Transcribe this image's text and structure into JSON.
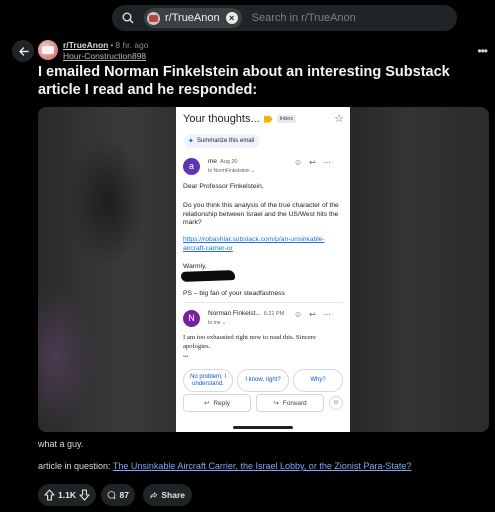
{
  "search": {
    "chip_label": "r/TrueAnon",
    "placeholder": "Search in r/TrueAnon"
  },
  "post": {
    "subreddit": "r/TrueAnon",
    "time": "8 hr. ago",
    "author": "Hour-Construction898",
    "title": "I emailed Norman Finkelstein about an interesting Substack article I read and he responded:",
    "caption": "what a guy.",
    "article_prefix": "article in question: ",
    "article_link": "The Unsinkable Aircraft Carrier, the Israel Lobby, or the Zionist Para-State?"
  },
  "email": {
    "subject": "Your thoughts...",
    "label": "Inbox",
    "summarize": "Summarize this email",
    "msg1": {
      "avatar_letter": "a",
      "from": "me",
      "date": "Aug 20",
      "to": "to NormFinkelstein",
      "greeting": "Dear Professor Finkelstein,",
      "question": "Do you think this analysis of the true character of the relationship between Israel and the US/West hits the mark?",
      "link": "https://robashlar.substack.com/p/an-unsinkable-aircraft-carrier-or",
      "signoff": "Warmly,",
      "ps": "PS – big fan of your steadfastness"
    },
    "msg2": {
      "avatar_letter": "N",
      "from": "Norman Finkelst...",
      "time": "6:21 PM",
      "to": "to me",
      "body": "I am too exhausted right now to read this.  Sincere apologies.",
      "ellipsis": "•••"
    },
    "smart_replies": [
      "No problem, I understand.",
      "I know, right?",
      "Why?"
    ],
    "reply_label": "Reply",
    "forward_label": "Forward"
  },
  "actions": {
    "votes": "1.1K",
    "comments": "87",
    "share": "Share"
  }
}
